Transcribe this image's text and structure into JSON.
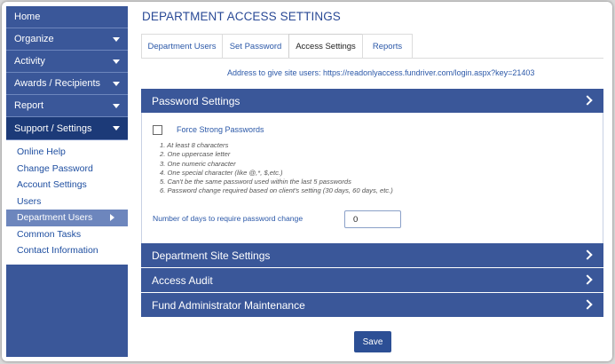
{
  "sidebar": {
    "items": [
      {
        "label": "Home",
        "caret": false
      },
      {
        "label": "Organize",
        "caret": true
      },
      {
        "label": "Activity",
        "caret": true
      },
      {
        "label": "Awards / Recipients",
        "caret": true
      },
      {
        "label": "Report",
        "caret": true
      },
      {
        "label": "Support / Settings",
        "caret": true
      }
    ],
    "submenu": [
      {
        "label": "Online Help"
      },
      {
        "label": "Change Password"
      },
      {
        "label": "Account Settings"
      },
      {
        "label": "Users"
      },
      {
        "label": "Department Users"
      },
      {
        "label": "Common Tasks"
      },
      {
        "label": "Contact Information"
      }
    ]
  },
  "header": {
    "title": "DEPARTMENT ACCESS SETTINGS"
  },
  "tabs": [
    {
      "label": "Department Users"
    },
    {
      "label": "Set Password"
    },
    {
      "label": "Access Settings"
    },
    {
      "label": "Reports"
    }
  ],
  "address": {
    "text": "Address to give site users: https://readonlyaccess.fundriver.com/login.aspx?key=21403"
  },
  "password_panel": {
    "title": "Password Settings",
    "checkbox_label": "Force Strong Passwords",
    "rules": [
      "1. At least 8 characters",
      "2. One uppercase letter",
      "3. One numeric character",
      "4. One special character (like @,*, $,etc.)",
      "5. Can't be the same password used within the last 5 passwords",
      "6. Password change required based on client's setting (30 days, 60 days, etc.)"
    ],
    "days_label": "Number of days to require password change",
    "days_value": "0"
  },
  "sections": [
    {
      "title": "Department Site Settings"
    },
    {
      "title": "Access Audit"
    },
    {
      "title": "Fund Administrator Maintenance"
    }
  ],
  "save_label": "Save",
  "colors": {
    "primary": "#3a5799",
    "active_nav": "#1c3a78",
    "link": "#2b58a8"
  }
}
